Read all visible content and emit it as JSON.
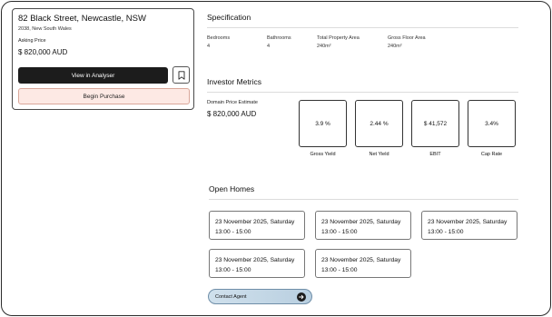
{
  "listing": {
    "address": "82 Black Street, Newcastle, NSW",
    "suburb_line": "2038, New South Wales",
    "asking_label": "Asking Price",
    "asking_price": "$ 820,000 AUD",
    "analyser_button": "View in Analyser",
    "bookmark_icon": "bookmark-icon",
    "purchase_button": "Begin Purchase"
  },
  "specification": {
    "title": "Specification",
    "items": [
      {
        "label": "Bedrooms",
        "value": "4"
      },
      {
        "label": "Bathrooms",
        "value": "4"
      },
      {
        "label": "Total Property Area",
        "value": "240m²"
      },
      {
        "label": "Gross Floor Area",
        "value": "240m²"
      }
    ]
  },
  "investor": {
    "title": "Investor Metrics",
    "estimate_label": "Domain Price Estimate",
    "estimate_value": "$ 820,000 AUD",
    "metrics": [
      {
        "value": "3.9 %",
        "label": "Gross Yield"
      },
      {
        "value": "2.44 %",
        "label": "Net Yield"
      },
      {
        "value": "$ 41,572",
        "label": "EBIT"
      },
      {
        "value": "3.4%",
        "label": "Cap Rate"
      }
    ]
  },
  "open_homes": {
    "title": "Open Homes",
    "slots": [
      {
        "date": "23 November 2025, Saturday",
        "time": "13:00 - 15:00"
      },
      {
        "date": "23 November 2025, Saturday",
        "time": "13:00 - 15:00"
      },
      {
        "date": "23 November 2025, Saturday",
        "time": "13:00 - 15:00"
      },
      {
        "date": "23 November 2025, Saturday",
        "time": "13:00 - 15:00"
      },
      {
        "date": "23 November 2025, Saturday",
        "time": "13:00 - 15:00"
      }
    ],
    "contact_button": "Contact Agent",
    "contact_icon": "arrow-right-icon"
  },
  "colors": {
    "primary_dark": "#1c1c1c",
    "purchase_bg": "#fde9e4",
    "contact_bg": "#c4d8e6"
  }
}
